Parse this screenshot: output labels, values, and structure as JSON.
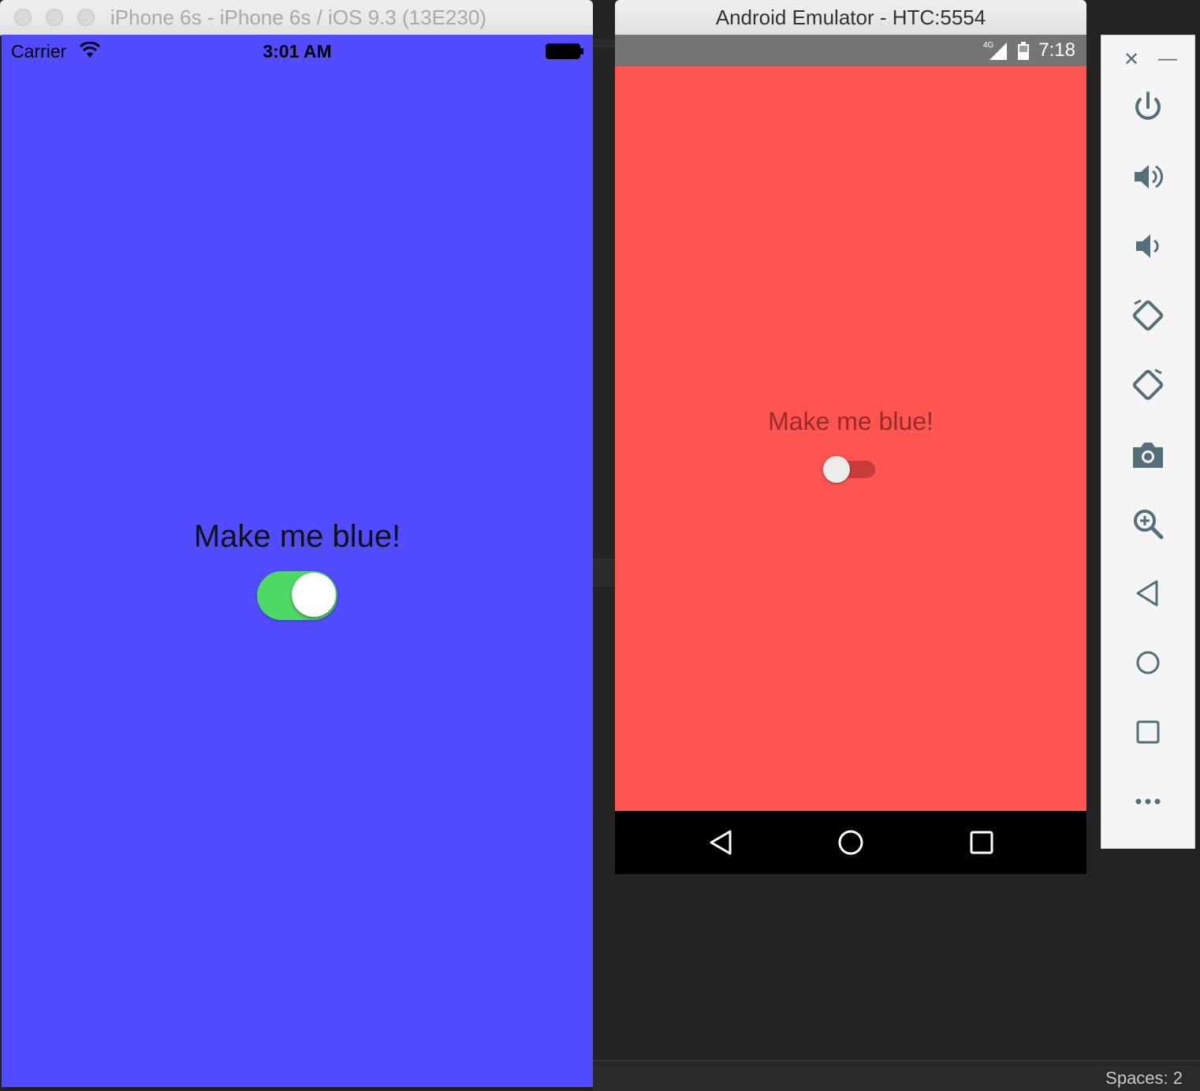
{
  "ios": {
    "window_title": "iPhone 6s - iPhone 6s / iOS 9.3 (13E230)",
    "carrier": "Carrier",
    "time": "3:01 AM",
    "label": "Make me blue!",
    "switch_on": true,
    "colors": {
      "screen": "#514cff",
      "switch_on": "#4cd964"
    }
  },
  "android": {
    "window_title": "Android Emulator - HTC:5554",
    "network": "4G",
    "time": "7:18",
    "label": "Make me blue!",
    "switch_on": false,
    "colors": {
      "screen": "#ff5450",
      "status_bar": "#757575"
    }
  },
  "toolbar": {
    "items": [
      "power-icon",
      "volume-up-icon",
      "volume-down-icon",
      "rotate-left-icon",
      "rotate-right-icon",
      "camera-icon",
      "zoom-icon",
      "back-icon",
      "home-icon",
      "overview-icon",
      "more-icon"
    ]
  },
  "ide": {
    "spaces": "Spaces: 2"
  }
}
